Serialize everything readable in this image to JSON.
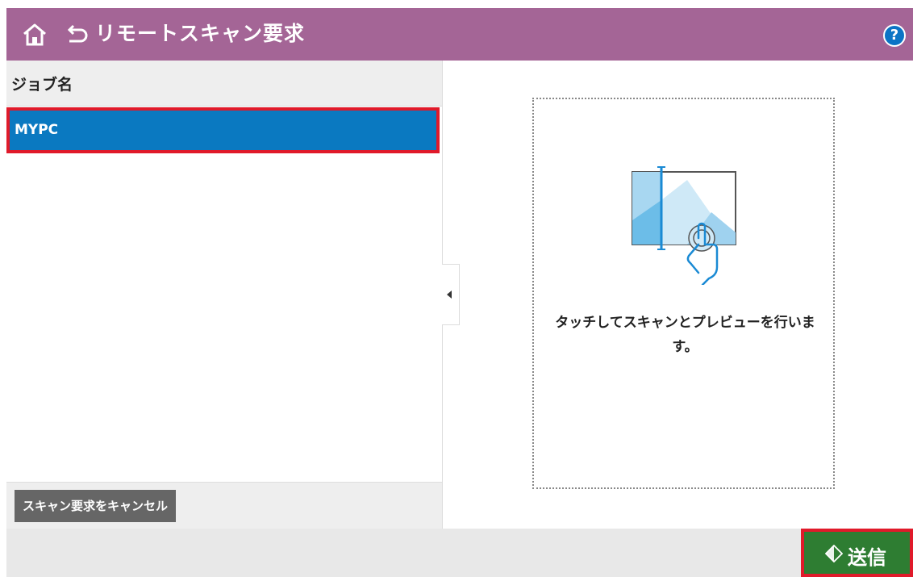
{
  "header": {
    "title": "リモートスキャン要求",
    "help_label": "?"
  },
  "job_list": {
    "column_header": "ジョブ名",
    "items": [
      {
        "name": "MYPC",
        "selected": true
      }
    ]
  },
  "cancel_button_label": "スキャン要求をキャンセル",
  "preview": {
    "instruction": "タッチしてスキャンとプレビューを行います。"
  },
  "send_button_label": "送信",
  "colors": {
    "header_bg": "#a46596",
    "selected_row": "#0a79c1",
    "send_button": "#2e7d32",
    "highlight_border": "#e01a2a"
  },
  "icons": [
    "home-icon",
    "back-icon",
    "help-icon",
    "collapse-arrow-icon",
    "scan-preview-illustration",
    "send-icon"
  ]
}
